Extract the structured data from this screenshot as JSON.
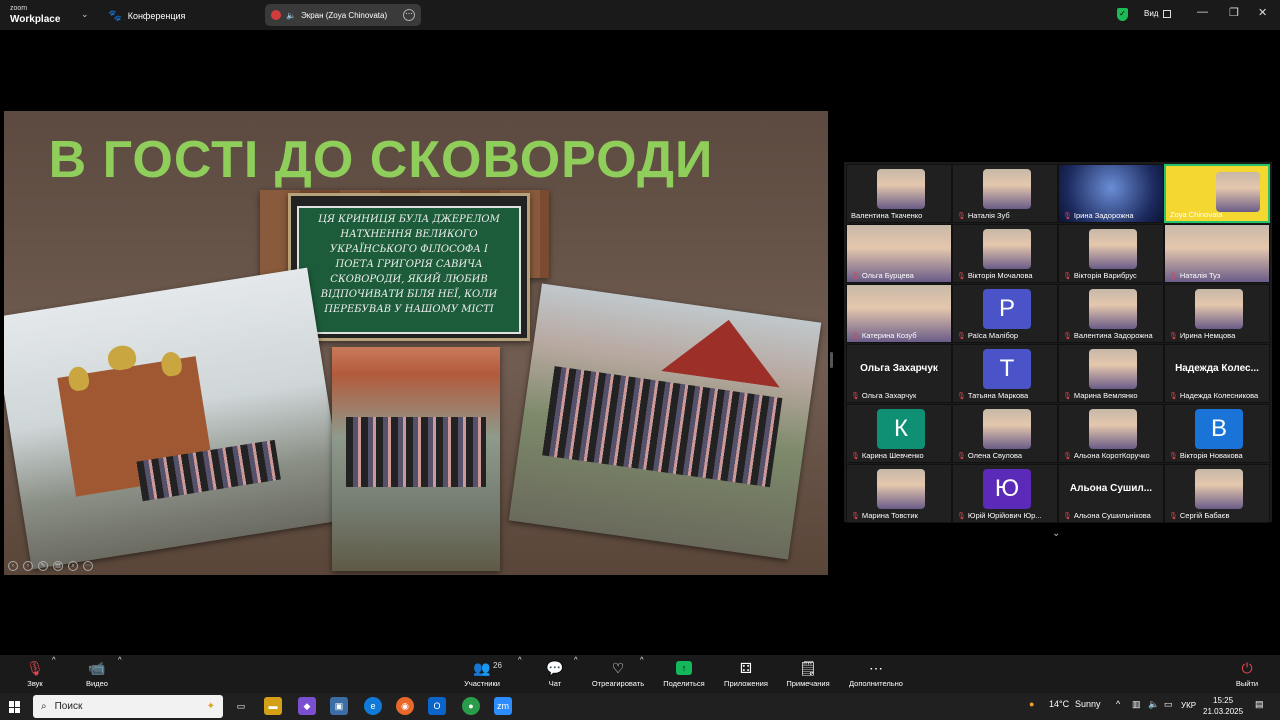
{
  "titlebar": {
    "logo_top": "zoom",
    "logo_bottom": "Workplace",
    "meeting_label": "Конференция",
    "screen_share_label": "Экран (Zoya Chinovata)",
    "view_label": "Вид"
  },
  "slide": {
    "title": "В ГОСТІ ДО СКОВОРОДИ",
    "plaque_lines": [
      "ЦЯ КРИНИЦЯ БУЛА ДЖЕРЕЛОМ",
      "НАТХНЕННЯ ВЕЛИКОГО",
      "УКРАЇНСЬКОГО ФІЛОСОФА І",
      "ПОЕТА ГРИГОРІЯ САВИЧА",
      "СКОВОРОДИ, ЯКИЙ ЛЮБИВ",
      "ВІДПОЧИВАТИ БІЛЯ НЕЇ, КОЛИ",
      "ПЕРЕБУВАВ У НАШОМУ МІСТІ"
    ]
  },
  "gallery": {
    "participants": [
      {
        "name": "Валентина Ткаченко",
        "muted": false
      },
      {
        "name": "Наталія Зуб",
        "muted": true
      },
      {
        "name": "Ірина Задорожна",
        "muted": true
      },
      {
        "name": "Zoya Chinovata",
        "muted": false
      },
      {
        "name": "Ольга Бурцева",
        "muted": true
      },
      {
        "name": "Вікторія Мочалова",
        "muted": true
      },
      {
        "name": "Вікторія Варибрус",
        "muted": true
      },
      {
        "name": "Наталія Туз",
        "muted": true
      },
      {
        "name": "Катерина Козуб",
        "muted": true
      },
      {
        "name": "Раїса Малібор",
        "muted": true,
        "avatar_letter": "Р",
        "avatar_color": "#4a54c8"
      },
      {
        "name": "Валентина Задорожна",
        "muted": true
      },
      {
        "name": "Ирина Немцова",
        "muted": true
      },
      {
        "name": "Ольга Захарчук",
        "muted": true,
        "big_name": "Ольга Захарчук"
      },
      {
        "name": "Татьяна Маркова",
        "muted": true,
        "avatar_letter": "Т",
        "avatar_color": "#4a54c8"
      },
      {
        "name": "Марина Вемлянко",
        "muted": true
      },
      {
        "name": "Надежда Колесникова",
        "muted": true,
        "big_name": "Надежда Колес..."
      },
      {
        "name": "Карина Шевченко",
        "muted": true,
        "avatar_letter": "К",
        "avatar_color": "#0f8f74"
      },
      {
        "name": "Олена Свулова",
        "muted": true
      },
      {
        "name": "Альона КоротКоручко",
        "muted": true
      },
      {
        "name": "Вікторія Новакова",
        "muted": true,
        "avatar_letter": "В",
        "avatar_color": "#1a73d6"
      },
      {
        "name": "Марина Товстик",
        "muted": true
      },
      {
        "name": "Юрій Юрійович Юр...",
        "muted": true,
        "avatar_letter": "Ю",
        "avatar_color": "#5b2ab8"
      },
      {
        "name": "Альона Сушильнікова",
        "muted": true,
        "big_name": "Альона Сушил..."
      },
      {
        "name": "Сергій Бабаєв",
        "muted": true
      }
    ]
  },
  "toolbar": {
    "audio": "Звук",
    "video": "Видео",
    "participants": "Участники",
    "participants_count": "26",
    "chat": "Чат",
    "react": "Отреагировать",
    "share": "Поделиться",
    "apps": "Приложения",
    "notes": "Примечания",
    "more": "Дополнительно",
    "leave": "Выйти"
  },
  "taskbar": {
    "search_placeholder": "Поиск",
    "weather_temp": "14°C",
    "weather_text": "Sunny",
    "language": "УКР",
    "time": "15:25",
    "date": "21.03.2025"
  }
}
